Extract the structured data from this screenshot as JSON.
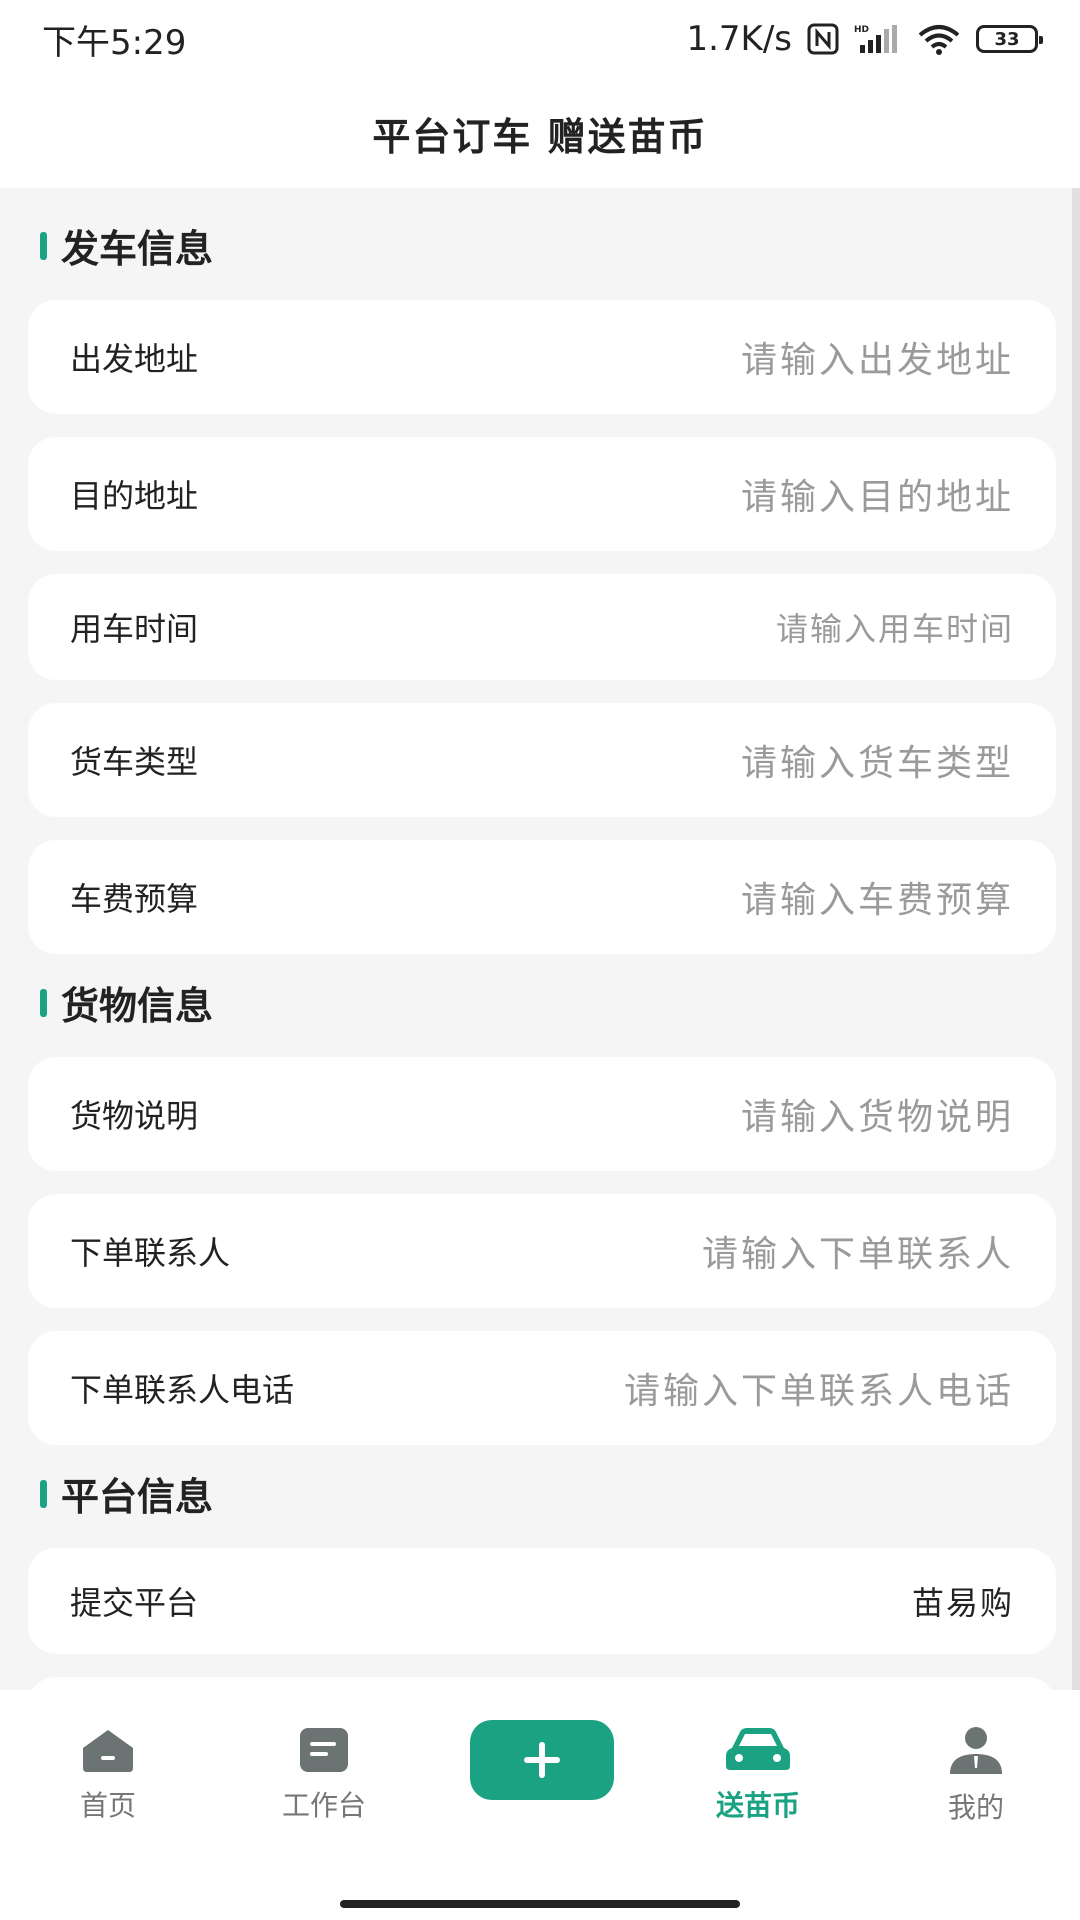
{
  "status_bar": {
    "time": "下午5:29",
    "net_speed": "1.7K/s",
    "battery": "33"
  },
  "header": {
    "title": "平台订车 赠送苗币"
  },
  "sections": {
    "departure": {
      "title": "发车信息",
      "fields": [
        {
          "label": "出发地址",
          "placeholder": "请输入出发地址"
        },
        {
          "label": "目的地址",
          "placeholder": "请输入目的地址"
        },
        {
          "label": "用车时间",
          "placeholder": "请输入用车时间"
        },
        {
          "label": "货车类型",
          "placeholder": "请输入货车类型"
        },
        {
          "label": "车费预算",
          "placeholder": "请输入车费预算"
        }
      ]
    },
    "cargo": {
      "title": "货物信息",
      "fields": [
        {
          "label": "货物说明",
          "placeholder": "请输入货物说明"
        },
        {
          "label": "下单联系人",
          "placeholder": "请输入下单联系人"
        },
        {
          "label": "下单联系人电话",
          "placeholder": "请输入下单联系人电话"
        }
      ]
    },
    "platform": {
      "title": "平台信息",
      "fields": [
        {
          "label": "提交平台",
          "value": "苗易购"
        }
      ]
    }
  },
  "bottom_nav": {
    "items": [
      {
        "label": "首页",
        "icon": "home-icon"
      },
      {
        "label": "工作台",
        "icon": "workbench-icon"
      },
      {
        "label": "",
        "icon": "plus-icon"
      },
      {
        "label": "送苗币",
        "icon": "car-icon",
        "active": true
      },
      {
        "label": "我的",
        "icon": "profile-icon"
      }
    ]
  },
  "colors": {
    "accent": "#1aa283",
    "background": "#f5f5f5",
    "placeholder": "#9a9a9a",
    "inactive_icon": "#6b7473"
  }
}
